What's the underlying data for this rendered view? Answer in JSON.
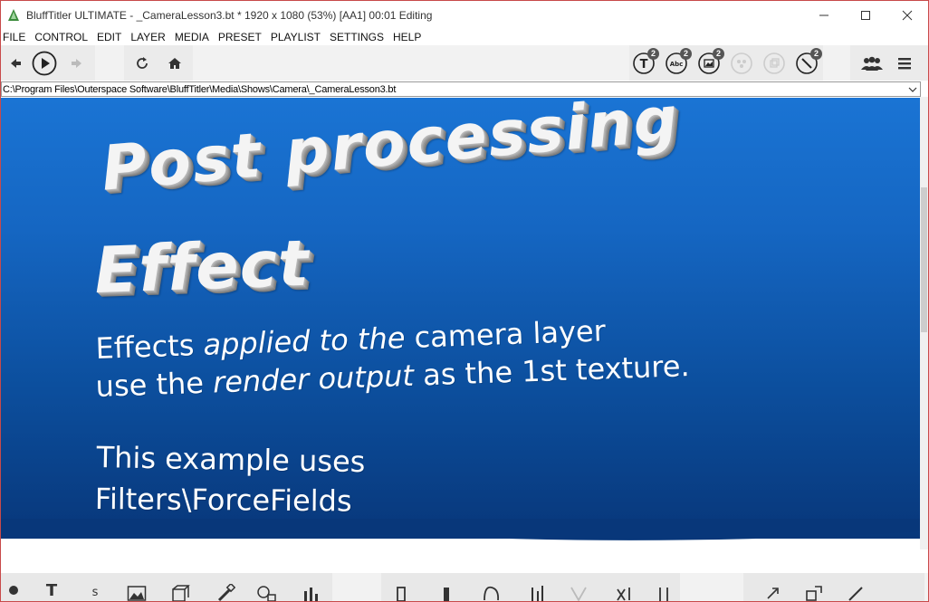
{
  "window": {
    "app_name": "BluffTitler ULTIMATE",
    "title_rest": " - _CameraLesson3.bt * 1920 x 1080 (53%) [AA1] 00:01 Editing",
    "minimize_label": "—",
    "maximize_label": "☐",
    "close_label": "✕"
  },
  "menu": {
    "items": [
      "FILE",
      "CONTROL",
      "EDIT",
      "LAYER",
      "MEDIA",
      "PRESET",
      "PLAYLIST",
      "SETTINGS",
      "HELP"
    ]
  },
  "toolbar": {
    "badges": {
      "text": "2",
      "abc": "2",
      "picture": "2",
      "tool": "2"
    },
    "text_icon_label": "T",
    "abc_icon_label": "Abc"
  },
  "pathbar": {
    "path": "C:\\Program Files\\Outerspace Software\\BluffTitler\\Media\\Shows\\Camera\\_CameraLesson3.bt"
  },
  "preview": {
    "heading1": "Post processing",
    "heading2": "Effect",
    "line1_a": "Effects ",
    "line1_b": "applied to the",
    "line1_c": " camera layer",
    "line2_a": "use the ",
    "line2_b": "render output",
    "line2_c": " as the 1st texture.",
    "line3": "This example uses",
    "line4": "Filters\\ForceFields"
  },
  "bottom_toolbar": {
    "text_label": "T",
    "small_text_label": "s"
  },
  "colors": {
    "preview_top": "#1a74d4",
    "preview_bottom": "#08377a",
    "toolbar_bg": "#f2f2f2",
    "badge": "#555555"
  }
}
